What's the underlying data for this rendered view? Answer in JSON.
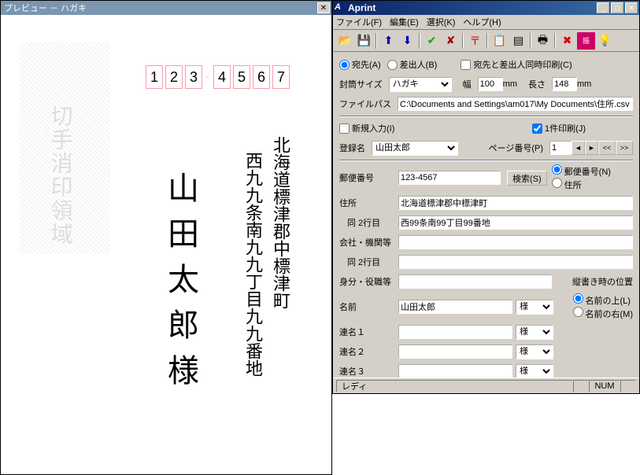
{
  "preview": {
    "title": "プレビュー － ハガキ",
    "postal": [
      "1",
      "2",
      "3",
      "4",
      "5",
      "6",
      "7"
    ],
    "stamp_text": "切手消印領域",
    "address1": "北海道標津郡中標津町",
    "address2": "西九九条南九九丁目九九番地",
    "name": "山田太郎様"
  },
  "main": {
    "title": "Aprint",
    "menu": {
      "file": "ファイル(F)",
      "edit": "編集(E)",
      "select": "選択(K)",
      "help": "ヘルプ(H)"
    },
    "dest": {
      "atena": "宛先(A)",
      "sashidashi": "差出人(B)",
      "both": "宛先と差出人同時印刷(C)"
    },
    "size_lbl": "封筒サイズ",
    "size_val": "ハガキ",
    "width_lbl": "幅",
    "width_val": "100",
    "width_unit": "mm",
    "height_lbl": "長さ",
    "height_val": "148",
    "height_unit": "mm",
    "path_lbl": "ファイルパス",
    "path_val": "C:\\Documents and Settings\\am017\\My Documents\\住所.csv",
    "newentry": "新規入力(I)",
    "oneprint": "1件印刷(J)",
    "reg_lbl": "登録名",
    "reg_val": "山田太郎",
    "page_lbl": "ページ番号(P)",
    "page_val": "1",
    "nav_prev": "◄",
    "nav_next": "►",
    "nav_first": "<<",
    "nav_last": ">>",
    "postal_lbl": "郵便番号",
    "postal_val": "123-4567",
    "search_btn": "検索(S)",
    "opt_postal": "郵便番号(N)",
    "opt_addr": "住所",
    "addr_lbl": "住所",
    "addr_val": "北海道標津郡中標津町",
    "addr2_lbl": "同 2行目",
    "addr2_val": "西99条南99丁目99番地",
    "org_lbl": "会社・機関等",
    "org_val": "",
    "org2_lbl": "同 2行目",
    "org2_val": "",
    "title_lbl": "身分・役職等",
    "title_val": "",
    "vpos_lbl": "縦書き時の位置",
    "vpos_above": "名前の上(L)",
    "vpos_right": "名前の右(M)",
    "name_lbl": "名前",
    "name_val": "山田太郎",
    "suffix": "様",
    "ren1_lbl": "連名１",
    "ren2_lbl": "連名２",
    "ren3_lbl": "連名３",
    "status": "レディ",
    "num": "NUM"
  }
}
